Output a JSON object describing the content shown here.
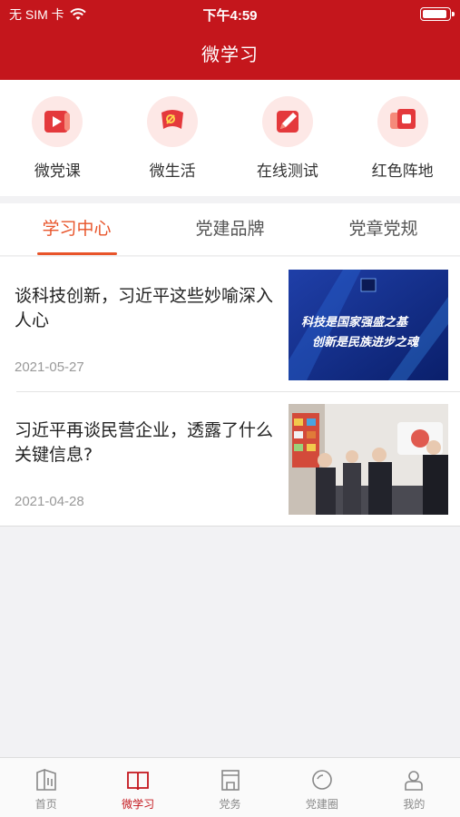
{
  "status_bar": {
    "carrier": "无 SIM 卡",
    "time": "下午4:59",
    "battery_level": 0.9
  },
  "header": {
    "title": "微学习",
    "color": "#c4161c"
  },
  "quick_actions": [
    {
      "label": "微党课",
      "icon": "video-scroll-icon"
    },
    {
      "label": "微生活",
      "icon": "party-flag-icon"
    },
    {
      "label": "在线测试",
      "icon": "pencil-test-icon"
    },
    {
      "label": "红色阵地",
      "icon": "red-base-icon"
    }
  ],
  "tabs": [
    {
      "label": "学习中心",
      "active": true
    },
    {
      "label": "党建品牌",
      "active": false
    },
    {
      "label": "党章党规",
      "active": false
    }
  ],
  "articles": [
    {
      "title": "谈科技创新，习近平这些妙喻深入人心",
      "date": "2021-05-27",
      "thumb_lines": [
        "科技是国家强盛之基",
        "创新是民族进步之魂"
      ]
    },
    {
      "title": "习近平再谈民营企业，透露了什么关键信息?",
      "date": "2021-04-28"
    }
  ],
  "tab_bar": [
    {
      "label": "首页",
      "icon": "home-icon",
      "active": false
    },
    {
      "label": "微学习",
      "icon": "book-icon",
      "active": true
    },
    {
      "label": "党务",
      "icon": "party-affairs-icon",
      "active": false
    },
    {
      "label": "党建圈",
      "icon": "circle-icon",
      "active": false
    },
    {
      "label": "我的",
      "icon": "profile-icon",
      "active": false
    }
  ],
  "accent_color": "#e8542a"
}
